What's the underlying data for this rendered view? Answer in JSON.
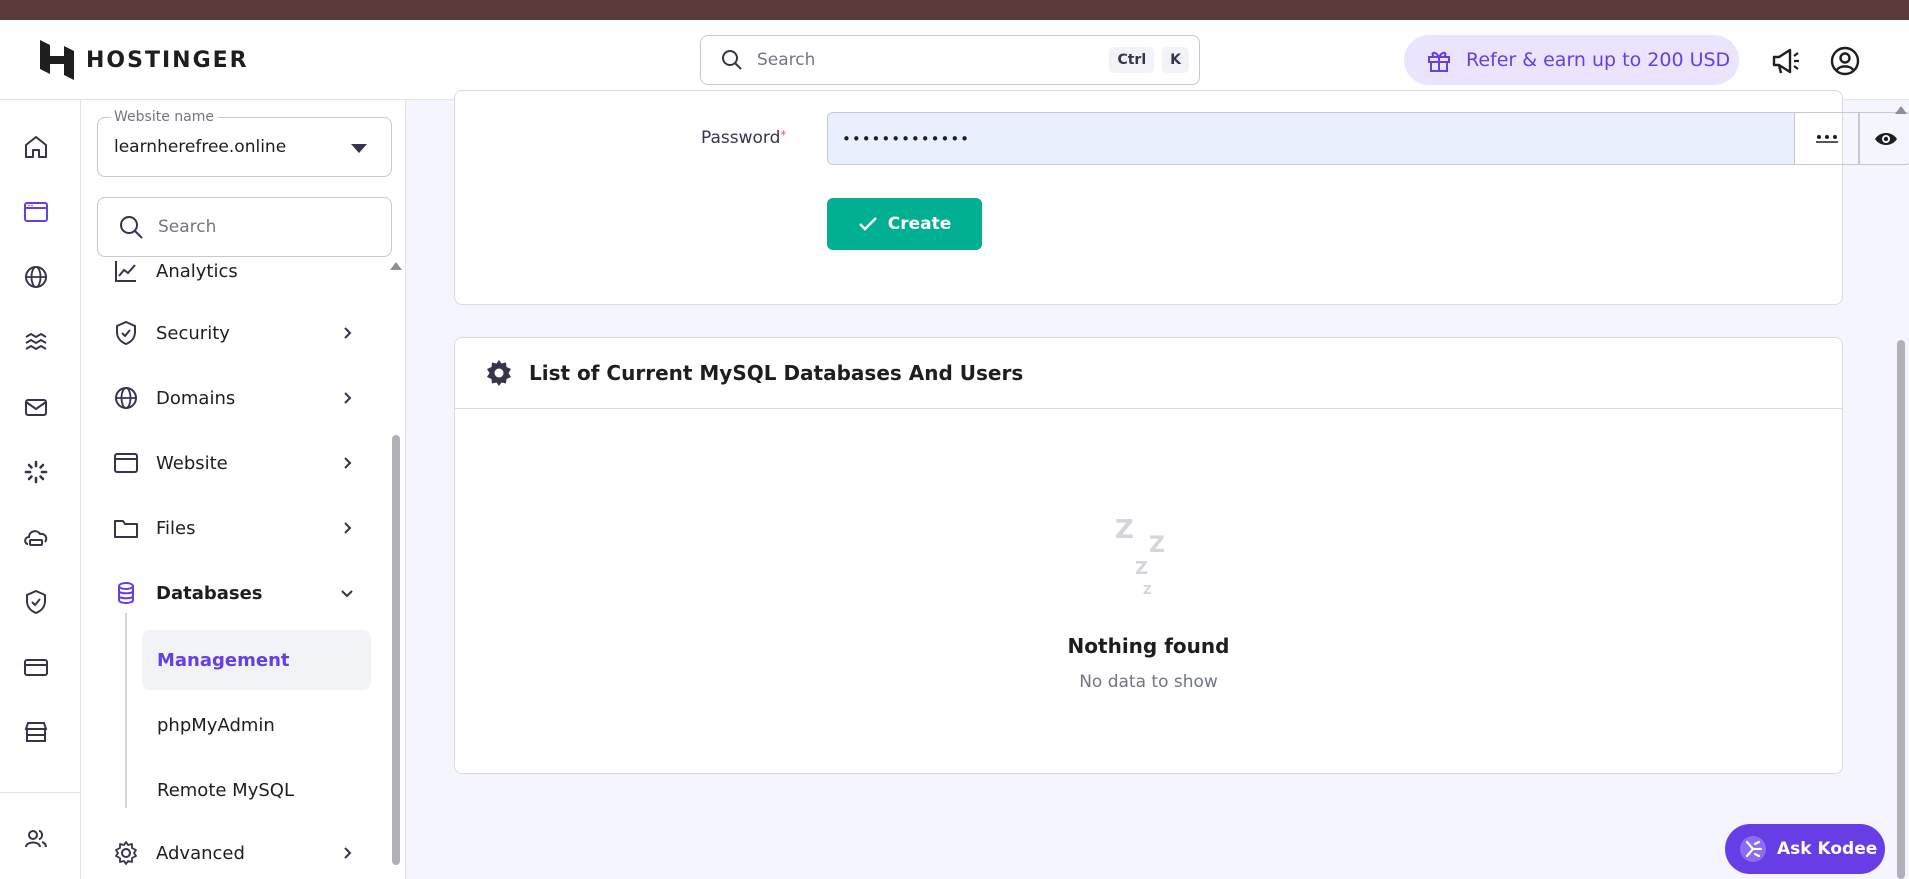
{
  "brand": {
    "name": "HOSTINGER"
  },
  "topbar": {
    "search_placeholder": "Search",
    "shortcut_ctrl": "Ctrl",
    "shortcut_k": "K",
    "refer_label": "Refer & earn up to 200 USD"
  },
  "sidebar": {
    "website_label": "Website name",
    "website_value": "learnherefree.online",
    "search_placeholder": "Search",
    "items": [
      {
        "label": "Analytics",
        "icon": "analytics-icon"
      },
      {
        "label": "Security",
        "icon": "shield-icon"
      },
      {
        "label": "Domains",
        "icon": "globe-icon"
      },
      {
        "label": "Website",
        "icon": "browser-icon"
      },
      {
        "label": "Files",
        "icon": "folder-icon"
      },
      {
        "label": "Databases",
        "icon": "database-icon"
      },
      {
        "label": "Advanced",
        "icon": "gear-icon"
      }
    ],
    "sub_items": [
      {
        "label": "Management",
        "active": true
      },
      {
        "label": "phpMyAdmin",
        "active": false
      },
      {
        "label": "Remote MySQL",
        "active": false
      }
    ]
  },
  "form": {
    "password_label": "Password",
    "password_required": "*",
    "password_value": "•••••••••••••",
    "create_label": "Create"
  },
  "list": {
    "title": "List of Current MySQL Databases And Users",
    "empty_title": "Nothing found",
    "empty_subtitle": "No data to show"
  },
  "assistant": {
    "label": "Ask Kodee"
  },
  "colors": {
    "accent": "#673de6",
    "success": "#00b090",
    "refer_bg": "#ebe4ff"
  }
}
